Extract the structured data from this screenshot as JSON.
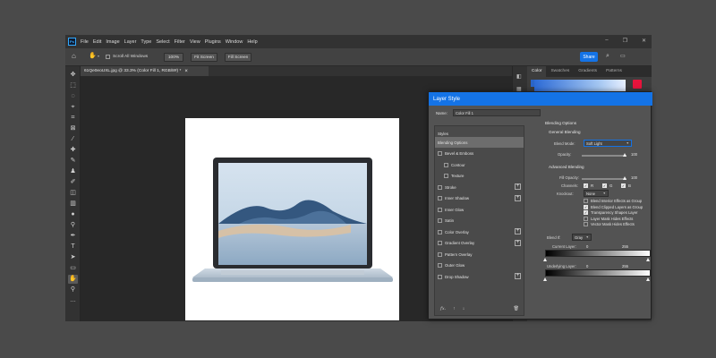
{
  "app": {
    "logo": "Ps"
  },
  "menu": [
    "File",
    "Edit",
    "Image",
    "Layer",
    "Type",
    "Select",
    "Filter",
    "View",
    "Plugins",
    "Window",
    "Help"
  ],
  "window_controls": {
    "minimize": "–",
    "restore": "❐",
    "close": "✕"
  },
  "options_bar": {
    "scroll_all_windows": "Scroll All Windows",
    "zoom_100": "100%",
    "fit_screen": "Fit Screen",
    "fill_screen": "Fill Screen",
    "share": "Share"
  },
  "document_tab": {
    "title": "61Qe0eoUXL.jpg @ 33.3% (Color Fill 1, RGB/8#) *",
    "close": "×"
  },
  "right_panel": {
    "tabs": [
      "Color",
      "Swatches",
      "Gradients",
      "Patterns"
    ],
    "active_tab": "Color",
    "accent": "#e8143c"
  },
  "layer_style": {
    "title": "Layer Style",
    "name_label": "Name:",
    "name_value": "Color Fill 1",
    "styles_header": "Styles",
    "styles": [
      {
        "label": "Blending Options",
        "checkbox": false,
        "selected": true,
        "plus": false,
        "indent": false
      },
      {
        "label": "Bevel & Emboss",
        "checkbox": true,
        "checked": false,
        "plus": false,
        "indent": false
      },
      {
        "label": "Contour",
        "checkbox": true,
        "checked": false,
        "plus": false,
        "indent": true
      },
      {
        "label": "Texture",
        "checkbox": true,
        "checked": false,
        "plus": false,
        "indent": true
      },
      {
        "label": "Stroke",
        "checkbox": true,
        "checked": false,
        "plus": true,
        "indent": false
      },
      {
        "label": "Inner Shadow",
        "checkbox": true,
        "checked": false,
        "plus": true,
        "indent": false
      },
      {
        "label": "Inner Glow",
        "checkbox": true,
        "checked": false,
        "plus": false,
        "indent": false
      },
      {
        "label": "Satin",
        "checkbox": true,
        "checked": false,
        "plus": false,
        "indent": false
      },
      {
        "label": "Color Overlay",
        "checkbox": true,
        "checked": false,
        "plus": true,
        "indent": false
      },
      {
        "label": "Gradient Overlay",
        "checkbox": true,
        "checked": false,
        "plus": true,
        "indent": false
      },
      {
        "label": "Pattern Overlay",
        "checkbox": true,
        "checked": false,
        "plus": false,
        "indent": false
      },
      {
        "label": "Outer Glow",
        "checkbox": true,
        "checked": false,
        "plus": false,
        "indent": false
      },
      {
        "label": "Drop Shadow",
        "checkbox": true,
        "checked": false,
        "plus": true,
        "indent": false
      }
    ],
    "fx_label": "fx.",
    "blending_options": {
      "title": "Blending Options",
      "general": "General Blending",
      "blend_mode_label": "Blend Mode:",
      "blend_mode_value": "Soft Light",
      "opacity_label": "Opacity:",
      "opacity_value": "100",
      "advanced": "Advanced Blending",
      "fill_opacity_label": "Fill Opacity:",
      "fill_opacity_value": "100",
      "channels_label": "Channels:",
      "channels": [
        "R",
        "G",
        "B"
      ],
      "knockout_label": "Knockout:",
      "knockout_value": "None",
      "checks": [
        {
          "label": "Blend Interior Effects as Group",
          "checked": false
        },
        {
          "label": "Blend Clipped Layers as Group",
          "checked": true
        },
        {
          "label": "Transparency Shapes Layer",
          "checked": true
        },
        {
          "label": "Layer Mask Hides Effects",
          "checked": false
        },
        {
          "label": "Vector Mask Hides Effects",
          "checked": false
        }
      ],
      "blend_if_label": "Blend If:",
      "blend_if_value": "Gray",
      "current_layer_label": "Current Layer:",
      "current_layer_min": "0",
      "current_layer_max": "255",
      "underlying_layer_label": "Underlying Layer:",
      "underlying_layer_min": "0",
      "underlying_layer_max": "255"
    }
  }
}
